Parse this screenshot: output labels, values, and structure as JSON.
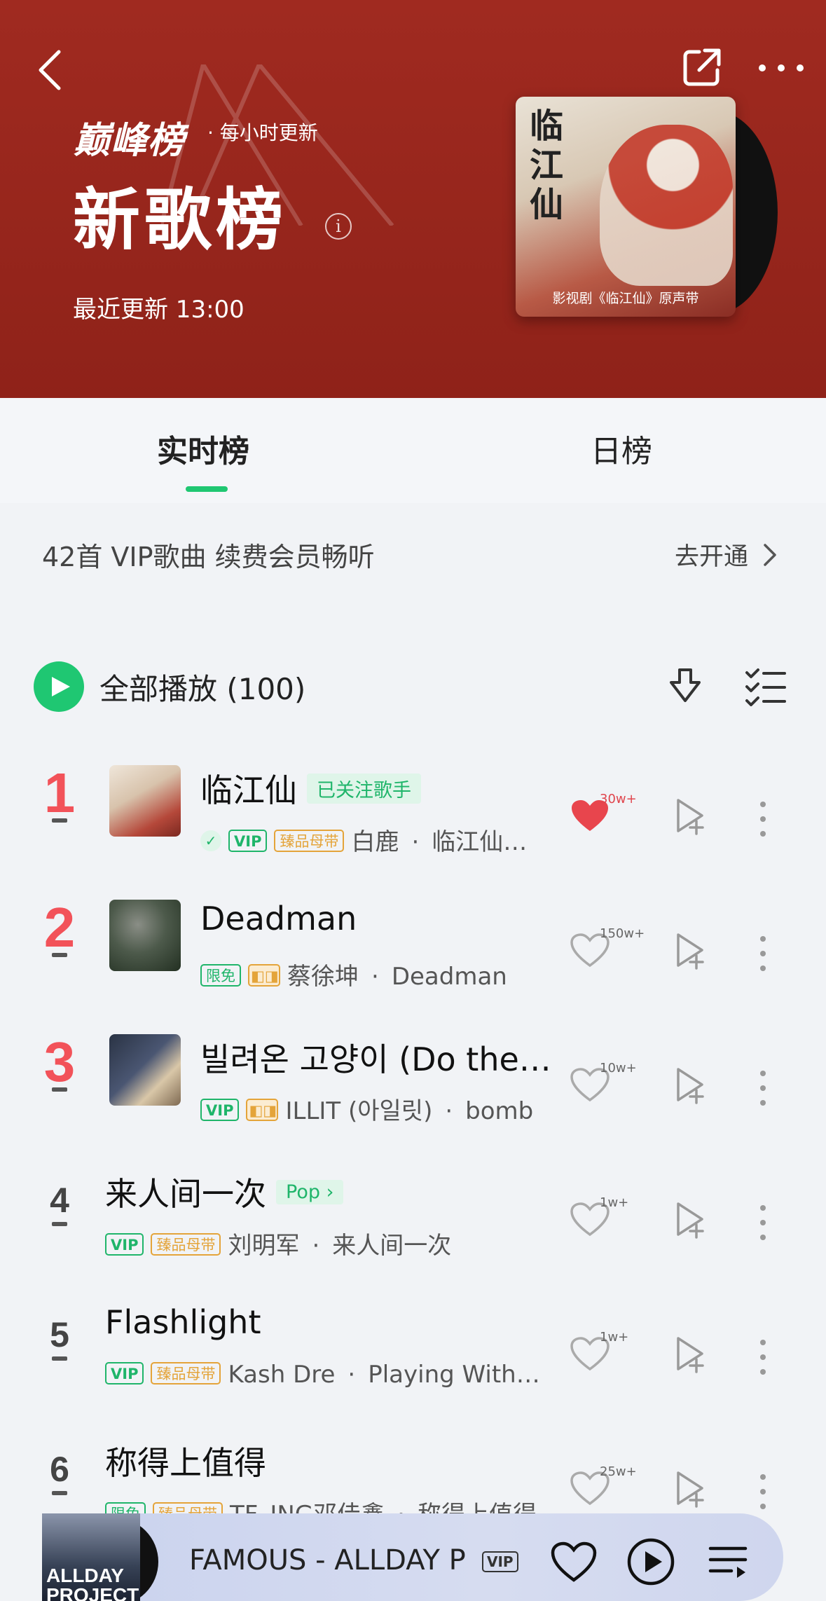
{
  "header": {
    "brand": "巅峰榜",
    "update_freq": "· 每小时更新",
    "title": "新歌榜",
    "info_glyph": "i",
    "last_updated": "最近更新 13:00",
    "cover_title": "临江仙",
    "cover_caption": "影视剧《临江仙》原声带",
    "icons": [
      "back-arrow-icon",
      "share-icon",
      "more-icon",
      "info-icon"
    ]
  },
  "tabs": [
    {
      "label": "实时榜",
      "active": true
    },
    {
      "label": "日榜",
      "active": false
    }
  ],
  "vip_banner": {
    "text": "42首 VIP歌曲 续费会员畅听",
    "link": "去开通"
  },
  "play_all": {
    "label": "全部播放 (100)"
  },
  "songs": [
    {
      "rank": "1",
      "title": "临江仙",
      "follow_tag": "已关注歌手",
      "badges": [
        "✓",
        "VIP",
        "臻品母带"
      ],
      "artist": "白鹿",
      "album": "临江仙…",
      "likes": "30w+",
      "liked": true
    },
    {
      "rank": "2",
      "title": "Deadman",
      "badges": [
        "限免",
        "DB"
      ],
      "artist": "蔡徐坤",
      "album": "Deadman",
      "likes": "150w+",
      "liked": false
    },
    {
      "rank": "3",
      "title": "빌려온 고양이 (Do the…",
      "badges": [
        "VIP",
        "DB"
      ],
      "artist": "ILLIT (아일릿)",
      "album": "bomb",
      "likes": "10w+",
      "liked": false
    },
    {
      "rank": "4",
      "title": "来人间一次",
      "genre_tag": "Pop",
      "badges": [
        "VIP",
        "臻品母带"
      ],
      "artist": "刘明军",
      "album": "来人间一次",
      "likes": "1w+",
      "liked": false
    },
    {
      "rank": "5",
      "title": "Flashlight",
      "badges": [
        "VIP",
        "臻品母带"
      ],
      "artist": "Kash Dre",
      "album": "Playing With…",
      "likes": "1w+",
      "liked": false
    },
    {
      "rank": "6",
      "title": "称得上值得",
      "badges": [
        "限免",
        "臻品母带"
      ],
      "artist": "TF_ING邓佳鑫",
      "album": "称得上值得",
      "likes": "25w+",
      "liked": false
    }
  ],
  "mini_player": {
    "art_text": "ALLDAY PROJECT",
    "title": "FAMOUS - ALLDAY P",
    "badge": "VIP"
  },
  "colors": {
    "header_bg": "#98251c",
    "accent_green": "#1fc772",
    "rank_red": "#f25259",
    "gold": "#e4a43a"
  }
}
